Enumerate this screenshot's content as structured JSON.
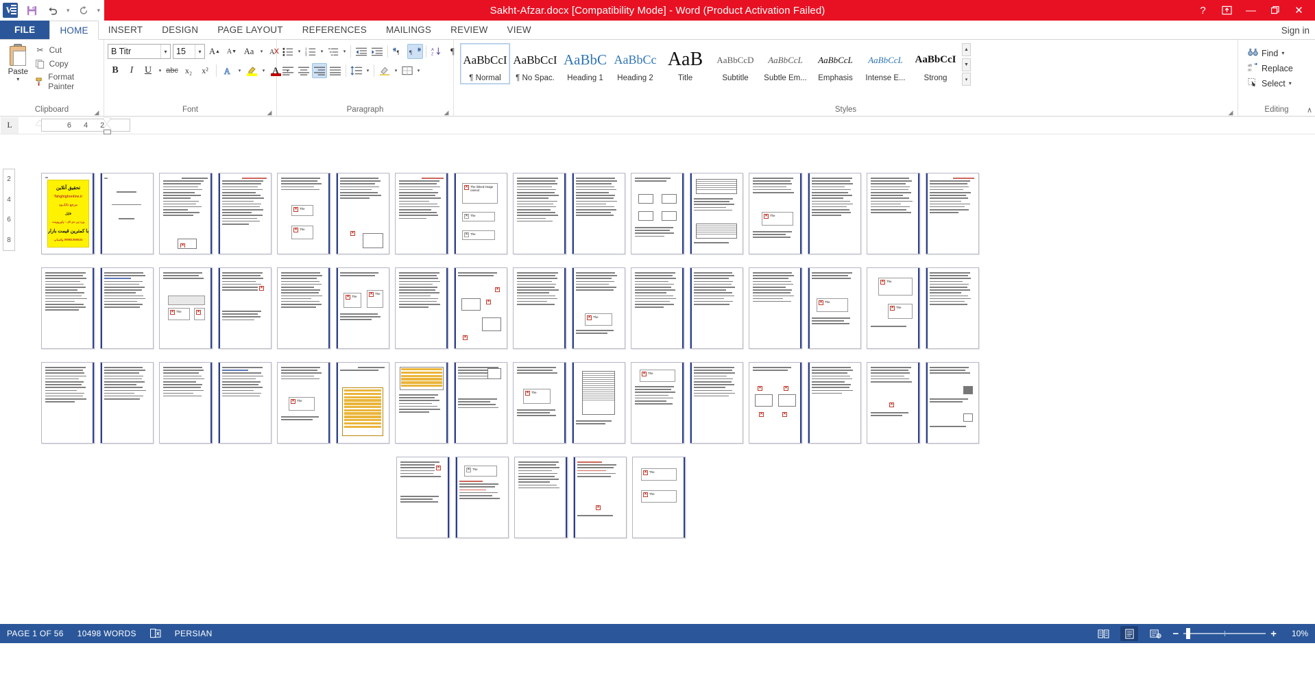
{
  "titlebar": {
    "title": "Sakht-Afzar.docx [Compatibility Mode]  -  Word (Product Activation Failed)",
    "qat": [
      {
        "name": "save-icon",
        "label": "Save"
      },
      {
        "name": "undo-icon",
        "label": "Undo"
      },
      {
        "name": "redo-icon",
        "label": "Redo"
      },
      {
        "name": "customize-qat-icon",
        "label": "Customize Quick Access Toolbar"
      }
    ],
    "help_label": "?",
    "ribbon_display_label": "Ribbon Display Options",
    "minimize_label": "—",
    "restore_label": "❐",
    "close_label": "✕"
  },
  "tabs": {
    "file": "FILE",
    "items": [
      {
        "label": "HOME",
        "active": true
      },
      {
        "label": "INSERT",
        "active": false
      },
      {
        "label": "DESIGN",
        "active": false
      },
      {
        "label": "PAGE LAYOUT",
        "active": false
      },
      {
        "label": "REFERENCES",
        "active": false
      },
      {
        "label": "MAILINGS",
        "active": false
      },
      {
        "label": "REVIEW",
        "active": false
      },
      {
        "label": "VIEW",
        "active": false
      }
    ],
    "signin": "Sign in"
  },
  "ribbon": {
    "clipboard": {
      "group_label": "Clipboard",
      "paste_label": "Paste",
      "items": [
        {
          "label": "Cut",
          "icon": "scissors-icon"
        },
        {
          "label": "Copy",
          "icon": "copy-icon"
        },
        {
          "label": "Format Painter",
          "icon": "paintbrush-icon"
        }
      ]
    },
    "font": {
      "group_label": "Font",
      "font_name": "B Titr",
      "font_size": "15",
      "grow_label": "A",
      "shrink_label": "A",
      "case_label": "Aa",
      "clear_label": "⌫",
      "bold": "B",
      "italic": "I",
      "underline": "U",
      "strikethrough": "abc",
      "subscript": "x₂",
      "superscript": "x²",
      "text_effects": "A",
      "highlight_color": "#FFFF00",
      "font_color": "#C00000"
    },
    "paragraph": {
      "group_label": "Paragraph",
      "bullets": "bullets-icon",
      "numbering": "numbering-icon",
      "multilevel": "multilevel-list-icon",
      "decrease_indent": "decrease-indent-icon",
      "increase_indent": "increase-indent-icon",
      "ltr": "left-to-right-icon",
      "rtl": "right-to-left-icon",
      "sort": "sort-icon",
      "show_marks": "show-formatting-marks-icon",
      "align_left": "align-left-icon",
      "align_center": "align-center-icon",
      "align_right": "align-right-icon",
      "justify": "justify-icon",
      "line_spacing": "line-spacing-icon",
      "shading": "shading-icon",
      "borders": "borders-icon"
    },
    "styles": {
      "group_label": "Styles",
      "items": [
        {
          "preview": "AaBbCcI",
          "name": "¶ Normal",
          "selected": true,
          "size": "17px",
          "color": "#111",
          "weight": "normal",
          "style": "normal"
        },
        {
          "preview": "AaBbCcI",
          "name": "¶ No Spac.",
          "selected": false,
          "size": "17px",
          "color": "#111",
          "weight": "normal",
          "style": "normal"
        },
        {
          "preview": "AaBbC",
          "name": "Heading 1",
          "selected": false,
          "size": "21px",
          "color": "#2E74B5",
          "weight": "normal",
          "style": "normal"
        },
        {
          "preview": "AaBbCc",
          "name": "Heading 2",
          "selected": false,
          "size": "18px",
          "color": "#2E74B5",
          "weight": "normal",
          "style": "normal"
        },
        {
          "preview": "AaB",
          "name": "Title",
          "selected": false,
          "size": "28px",
          "color": "#111",
          "weight": "normal",
          "style": "normal"
        },
        {
          "preview": "AaBbCcD",
          "name": "Subtitle",
          "selected": false,
          "size": "13px",
          "color": "#5A5A5A",
          "weight": "normal",
          "style": "normal"
        },
        {
          "preview": "AaBbCcL",
          "name": "Subtle Em...",
          "selected": false,
          "size": "13px",
          "color": "#5A5A5A",
          "weight": "normal",
          "style": "italic"
        },
        {
          "preview": "AaBbCcL",
          "name": "Emphasis",
          "selected": false,
          "size": "13px",
          "color": "#111",
          "weight": "normal",
          "style": "italic"
        },
        {
          "preview": "AaBbCcL",
          "name": "Intense E...",
          "selected": false,
          "size": "13px",
          "color": "#2E74B5",
          "weight": "normal",
          "style": "italic"
        },
        {
          "preview": "AaBbCcI",
          "name": "Strong",
          "selected": false,
          "size": "15px",
          "color": "#111",
          "weight": "bold",
          "style": "normal"
        }
      ],
      "scroll_up": "▲",
      "scroll_down": "▼",
      "more": "▾"
    },
    "editing": {
      "group_label": "Editing",
      "items": [
        {
          "label": "Find",
          "icon": "binoculars-icon",
          "caret": true
        },
        {
          "label": "Replace",
          "icon": "replace-icon",
          "caret": false
        },
        {
          "label": "Select",
          "icon": "select-icon",
          "caret": true
        }
      ]
    },
    "collapse_label": "∧"
  },
  "ruler": {
    "tab_selector": "L",
    "marks": [
      "6",
      "4",
      "2"
    ],
    "vertical_marks": [
      "2",
      "4",
      "6",
      "8"
    ]
  },
  "statusbar": {
    "page": "PAGE 1 OF 56",
    "words": "10498 WORDS",
    "proofing_icon": "proofing-errors-icon",
    "language": "PERSIAN",
    "views": [
      {
        "name": "read-mode-icon",
        "active": false
      },
      {
        "name": "print-layout-icon",
        "active": true
      },
      {
        "name": "web-layout-icon",
        "active": false
      }
    ],
    "zoom_out": "−",
    "zoom_in": "+",
    "zoom_level": "10%"
  },
  "document": {
    "total_pages": 56,
    "ad_page": {
      "lines": [
        "تحقیق آنلاین",
        "Tahghighonline.ir",
        "مرجع دانلــود",
        "فایل",
        "ورد-پی دی اف - پاورپوینت",
        "با کمترین قیمت بازار",
        "09981366624 واتساپ"
      ]
    },
    "broken_image_text": "The linked image cannot be displayed. The file may have been moved, renamed, or deleted. Verify that the link points to the correct file and location.",
    "broken_image_short": "The linked image cannot",
    "broken_image_tiny": "The"
  }
}
